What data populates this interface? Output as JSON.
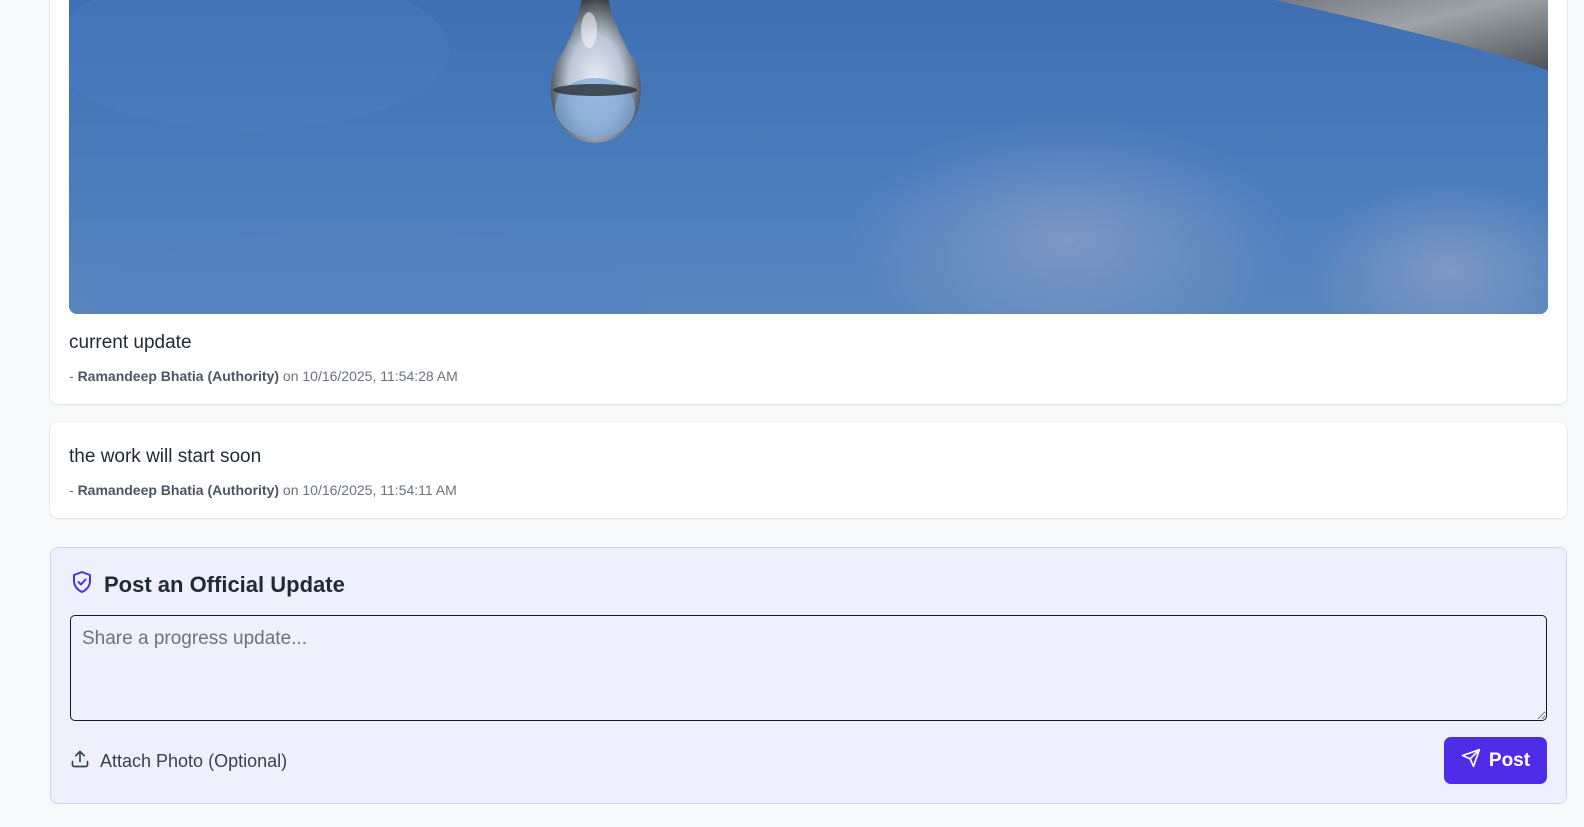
{
  "updates": [
    {
      "text": "current update",
      "meta_prefix": "- ",
      "author": "Ramandeep Bhatia (Authority)",
      "meta_suffix": " on 10/16/2025, 11:54:28 AM",
      "has_photo": true
    },
    {
      "text": "the work will start soon",
      "meta_prefix": "- ",
      "author": "Ramandeep Bhatia (Authority)",
      "meta_suffix": " on 10/16/2025, 11:54:11 AM",
      "has_photo": false
    }
  ],
  "post_panel": {
    "title": "Post an Official Update",
    "title_icon": "shield-check-icon",
    "placeholder": "Share a progress update...",
    "value": "",
    "attach_label": "Attach Photo (Optional)",
    "attach_icon": "upload-icon",
    "post_label": "Post",
    "post_icon": "send-icon"
  },
  "colors": {
    "accent": "#4f2de8",
    "panel_bg": "#eef1fd",
    "card_bg": "#ffffff",
    "page_bg": "#f8f9fb"
  }
}
